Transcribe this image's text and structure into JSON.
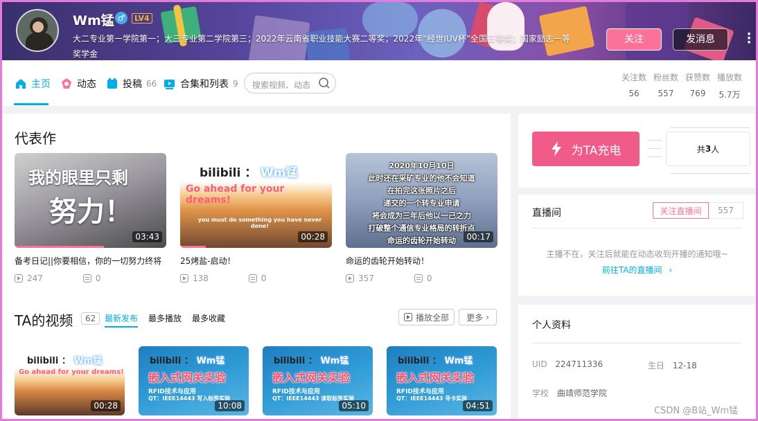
{
  "header": {
    "username": "Wm锰",
    "level": "LV4",
    "bio": "大二专业第一学院第一；大三专业第二学院第三；2022年云南省职业技能大赛二等奖；2022年“经世IUV杯”全国三等奖；国家励志一等奖学金",
    "follow_label": "关注",
    "message_label": "发消息"
  },
  "nav": {
    "tabs": [
      {
        "label": "主页",
        "count": ""
      },
      {
        "label": "动态",
        "count": ""
      },
      {
        "label": "投稿",
        "count": "66"
      },
      {
        "label": "合集和列表",
        "count": "9"
      }
    ],
    "search_placeholder": "搜索视频、动态",
    "stats": [
      {
        "label": "关注数",
        "value": "56"
      },
      {
        "label": "粉丝数",
        "value": "557"
      },
      {
        "label": "获赞数",
        "value": "769"
      },
      {
        "label": "播放数",
        "value": "5.7万"
      }
    ]
  },
  "masterpiece": {
    "title": "代表作",
    "videos": [
      {
        "title": "备考日记||你要相信，你的一切努力终将",
        "duration": "03:43",
        "plays": "247",
        "danmaku": "0",
        "progress": 0.59,
        "overlay": [
          "我的眼里只剩",
          "努力！"
        ]
      },
      {
        "title": "25烤盐-启动！",
        "duration": "00:28",
        "plays": "138",
        "danmaku": "0",
        "progress": 0.17,
        "overlay": [
          "Go ahead for your dreams!",
          "you must do something you have never done!"
        ]
      },
      {
        "title": "命运的齿轮开始转动！",
        "duration": "00:17",
        "plays": "357",
        "danmaku": "0",
        "progress": 0.0,
        "overlay": [
          "2020年10月10日",
          "此时还在采矿专业的他不会知道",
          "在拍完这张照片之后",
          "递交的一个转专业申请",
          "将会成为三年后他以一己之力",
          "打破整个通信专业格局的转折点",
          "命运的齿轮开始转动"
        ]
      }
    ]
  },
  "videos": {
    "title": "TA的视频",
    "count": "62",
    "subtabs": [
      "最新发布",
      "最多播放",
      "最多收藏"
    ],
    "play_all_label": "播放全部",
    "more_label": "更多",
    "items": [
      {
        "duration": "00:28",
        "overlay": [
          "Go ahead for your dreams!"
        ]
      },
      {
        "duration": "10:08",
        "overlay": [
          "嵌入式网关实验",
          "RFID技术与应用",
          "QT：IEEE14443 写入标签实验"
        ]
      },
      {
        "duration": "05:10",
        "overlay": [
          "嵌入式网关实验",
          "RFID技术与应用",
          "QT：IEEE14443 读取标签实验"
        ]
      },
      {
        "duration": "04:51",
        "overlay": [
          "嵌入式网关实验",
          "RFID技术与应用",
          "QT：IEEE14443 寻卡实验"
        ]
      }
    ],
    "brand_text": "bilibili",
    "brand_sep": "：",
    "brand_name": "Wm锰"
  },
  "charge": {
    "button_label": "为TA充电",
    "count_prefix": "共",
    "count_value": "3",
    "count_suffix": "人"
  },
  "live": {
    "title": "直播间",
    "follow_label": "关注直播间",
    "follow_count": "557",
    "empty_text": "主播不在，关注后就能在动态收到开播的通知哦~",
    "link_text": "前往TA的直播间"
  },
  "profile": {
    "title": "个人资料",
    "uid_label": "UID",
    "uid_value": "224711336",
    "birthday_label": "生日",
    "birthday_value": "12-18",
    "school_label": "学校",
    "school_value": "曲靖师范学院"
  },
  "watermark": "CSDN @B站_Wm锰",
  "colors": {
    "accent": "#00aeec",
    "pink": "#fb7299",
    "charge": "#f15b8a"
  }
}
